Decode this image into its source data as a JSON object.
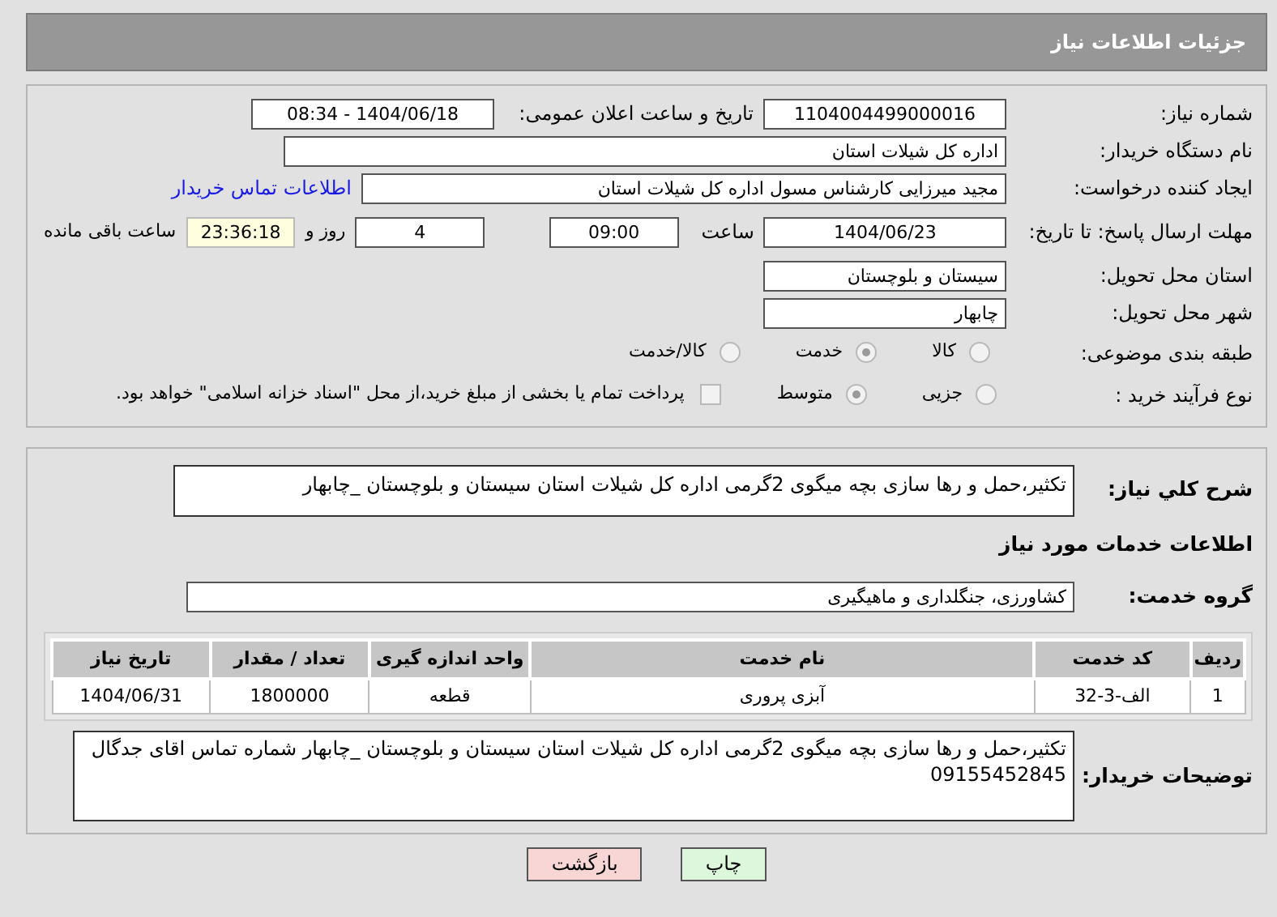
{
  "header": {
    "title": "جزئیات اطلاعات نیاز"
  },
  "need_number": {
    "label": "شماره نیاز:",
    "value": "1104004499000016"
  },
  "announce": {
    "label": "تاریخ و ساعت اعلان عمومی:",
    "value": "1404/06/18 - 08:34"
  },
  "buyer_org": {
    "label": "نام دستگاه خریدار:",
    "value": "اداره کل شیلات استان"
  },
  "requester": {
    "label": "ایجاد کننده درخواست:",
    "value": "مجید میرزایی کارشناس مسول  اداره کل شیلات استان",
    "link": "اطلاعات تماس خریدار"
  },
  "deadline": {
    "label": "مهلت ارسال پاسخ: تا تاریخ:",
    "date": "1404/06/23",
    "time_label": "ساعت",
    "time": "09:00",
    "days": "4",
    "days_label": "روز و",
    "remaining": "23:36:18",
    "remaining_label": "ساعت باقی مانده"
  },
  "province": {
    "label": "استان محل تحویل:",
    "value": "سیستان و بلوچستان"
  },
  "city": {
    "label": "شهر محل تحویل:",
    "value": "چابهار"
  },
  "category": {
    "label": "طبقه بندی موضوعی:",
    "options": [
      {
        "label": "کالا",
        "selected": false
      },
      {
        "label": "خدمت",
        "selected": true
      },
      {
        "label": "کالا/خدمت",
        "selected": false
      }
    ]
  },
  "process": {
    "label": "نوع فرآیند خرید :",
    "options": [
      {
        "label": "جزیی",
        "selected": false
      },
      {
        "label": "متوسط",
        "selected": true
      }
    ],
    "payment": {
      "checked": false,
      "text": "پرداخت تمام یا بخشی از مبلغ خرید،از محل \"اسناد خزانه اسلامی\" خواهد بود."
    }
  },
  "description": {
    "label": "شرح کلي نياز:",
    "value": "تکثیر،حمل و رها سازی بچه میگوی 2گرمی  اداره کل شیلات استان سیستان و بلوچستان _چابهار"
  },
  "services_title": "اطلاعات خدمات مورد نياز",
  "service_group": {
    "label": "گروه خدمت:",
    "value": "کشاورزی، جنگلداری و ماهیگیری"
  },
  "table": {
    "columns": [
      "ردیف",
      "کد خدمت",
      "نام خدمت",
      "واحد اندازه گیری",
      "تعداد / مقدار",
      "تاریخ نیاز"
    ],
    "rows": [
      [
        "1",
        "الف-3-32",
        "آبزی پروری",
        "قطعه",
        "1800000",
        "1404/06/31"
      ]
    ]
  },
  "buyer_notes": {
    "label": "توضیحات خریدار:",
    "value": "تکثیر،حمل و رها سازی بچه میگوی 2گرمی  اداره کل شیلات استان سیستان و بلوچستان _چابهار  شماره تماس اقای جدگال 09155452845"
  },
  "buttons": [
    {
      "label": "چاپ",
      "kind": "print"
    },
    {
      "label": "بازگشت",
      "kind": "back"
    }
  ]
}
